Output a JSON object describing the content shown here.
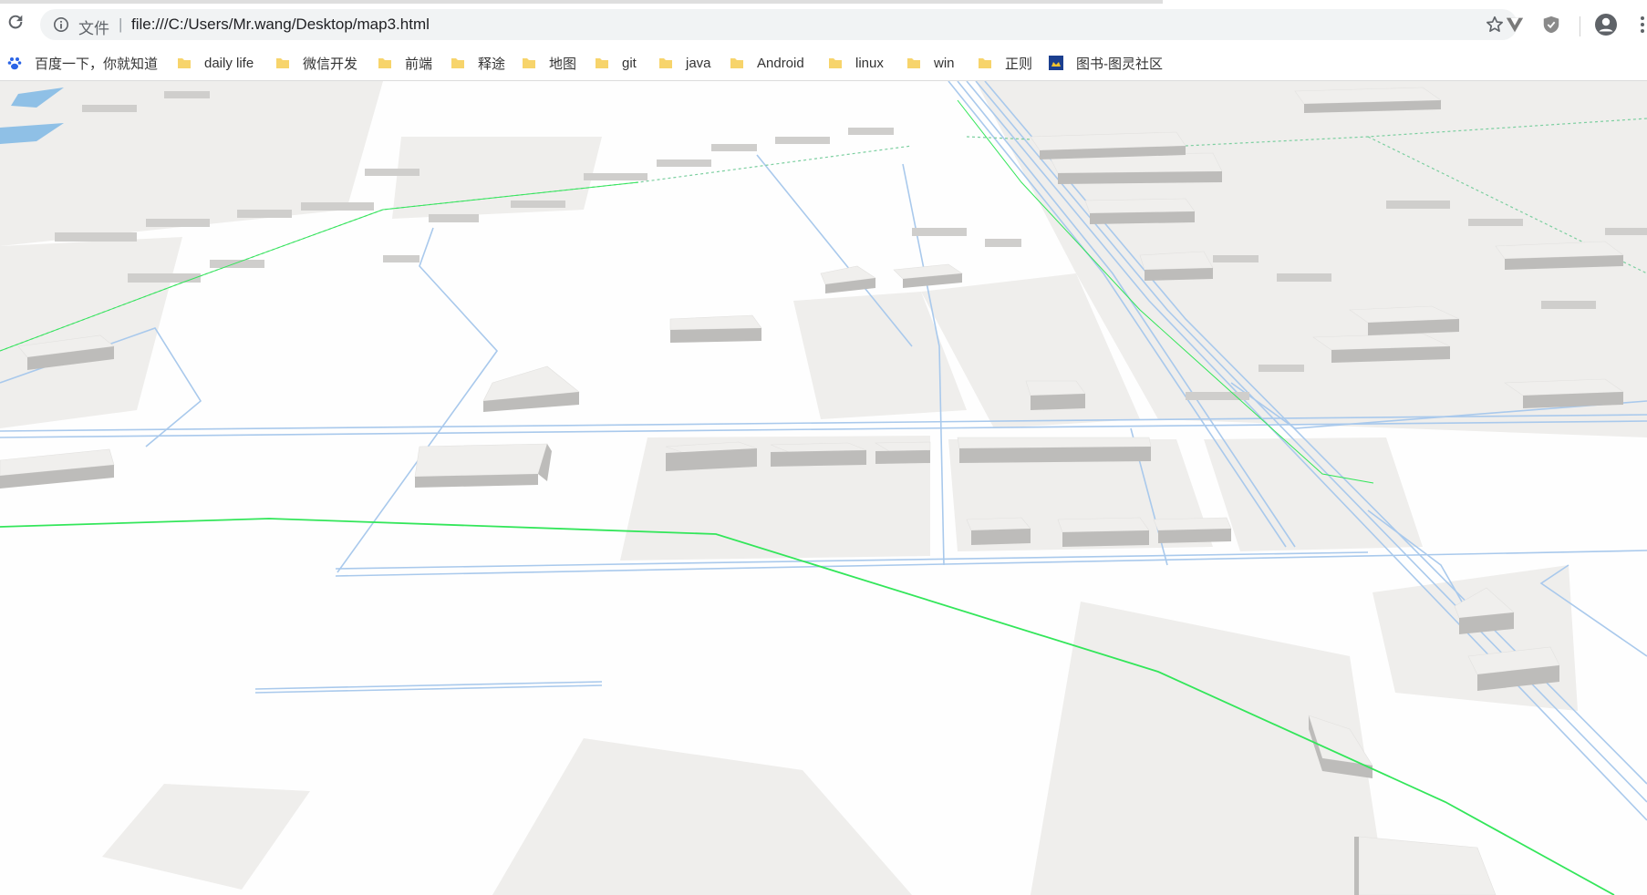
{
  "browser": {
    "address_prefix": "文件",
    "separator": "|",
    "url": "file:///C:/Users/Mr.wang/Desktop/map3.html"
  },
  "bookmarks": [
    {
      "label": "百度一下，你就知道",
      "icon": "baidu-paw-icon"
    },
    {
      "label": "daily life",
      "icon": "folder-icon"
    },
    {
      "label": "微信开发",
      "icon": "folder-icon"
    },
    {
      "label": "前端",
      "icon": "folder-icon"
    },
    {
      "label": "释途",
      "icon": "folder-icon"
    },
    {
      "label": "地图",
      "icon": "folder-icon"
    },
    {
      "label": "git",
      "icon": "folder-icon"
    },
    {
      "label": "java",
      "icon": "folder-icon"
    },
    {
      "label": "Android",
      "icon": "folder-icon"
    },
    {
      "label": "linux",
      "icon": "folder-icon"
    },
    {
      "label": "win",
      "icon": "folder-icon"
    },
    {
      "label": "正则",
      "icon": "folder-icon"
    },
    {
      "label": "图书-图灵社区",
      "icon": "turing-favicon"
    }
  ],
  "map": {
    "view": "3D perspective city map",
    "colors": {
      "ground": "#fefefe",
      "block": "#efeeec",
      "building_top": "#f0efed",
      "building_side": "#bdbcba",
      "road": "#a9c9ec",
      "route": "#33e65a",
      "water": "#8fc0e6"
    }
  }
}
